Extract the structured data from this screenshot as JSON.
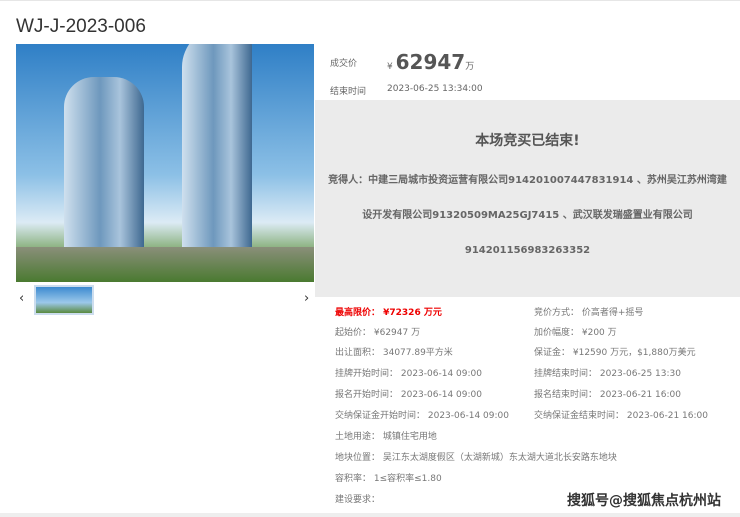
{
  "title": "WJ-J-2023-006",
  "deal": {
    "price_label": "成交价",
    "currency": "¥",
    "price": "62947",
    "unit": "万",
    "end_label": "结束时间",
    "end_time": "2023-06-25 13:34:00"
  },
  "result": {
    "heading": "本场竞买已结束!",
    "winner_line1": "竞得人：中建三局城市投资运营有限公司914201007447831914 、苏州吴江苏州湾建",
    "winner_line2": "设开发有限公司91320509MA25GJ7415 、武汉联发瑞盛置业有限公司",
    "winner_line3": "914201156983263352"
  },
  "details": {
    "max_price": "最高限价：  ¥72326 万元",
    "bid_method": "竞价方式：  价高者得+摇号",
    "start_price": "起始价：  ¥62947 万",
    "increment": "加价幅度：  ¥200 万",
    "area": "出让面积：  34077.89平方米",
    "deposit": "保证金：  ¥12590 万元，$1,880万美元",
    "listing_start": "挂牌开始时间：  2023-06-14 09:00",
    "listing_end": "挂牌结束时间：  2023-06-25 13:30",
    "signup_start": "报名开始时间：  2023-06-14 09:00",
    "signup_end": "报名结束时间：  2023-06-21 16:00",
    "deposit_start": "交纳保证金开始时间：  2023-06-14 09:00",
    "deposit_end": "交纳保证金结束时间：  2023-06-21 16:00",
    "land_use": "土地用途：  城镇住宅用地",
    "location": "地块位置：  吴江东太湖度假区（太湖新城）东太湖大道北长安路东地块",
    "far": "容积率：  1≤容积率≤1.80",
    "requirements": "建设要求："
  },
  "watermark": "搜狐号@搜狐焦点杭州站"
}
